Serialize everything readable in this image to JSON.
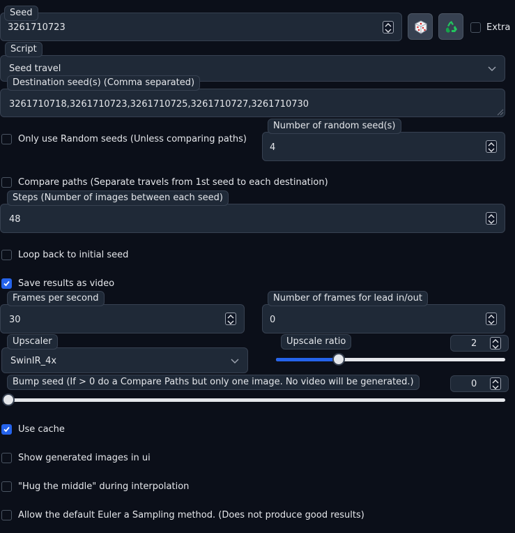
{
  "seed": {
    "label": "Seed",
    "value": "3261710723",
    "extra_label": "Extra"
  },
  "script": {
    "label": "Script",
    "selected": "Seed travel"
  },
  "destination_seeds": {
    "label": "Destination seed(s) (Comma separated)",
    "value": "3261710718,3261710723,3261710725,3261710727,3261710730"
  },
  "only_random": {
    "label": "Only use Random seeds (Unless comparing paths)",
    "checked": false
  },
  "num_random": {
    "label": "Number of random seed(s)",
    "value": "4"
  },
  "compare_paths": {
    "label": "Compare paths (Separate travels from 1st seed to each destination)",
    "checked": false
  },
  "steps": {
    "label": "Steps (Number of images between each seed)",
    "value": "48"
  },
  "loop_back": {
    "label": "Loop back to initial seed",
    "checked": false
  },
  "save_video": {
    "label": "Save results as video",
    "checked": true
  },
  "fps": {
    "label": "Frames per second",
    "value": "30"
  },
  "lead_frames": {
    "label": "Number of frames for lead in/out",
    "value": "0"
  },
  "upscaler": {
    "label": "Upscaler",
    "selected": "SwinIR_4x"
  },
  "upscale_ratio": {
    "label": "Upscale ratio",
    "value": "2",
    "slider_fraction": 0.26
  },
  "bump_seed": {
    "label": "Bump seed (If > 0 do a Compare Paths but only one image. No video will be generated.)",
    "value": "0",
    "slider_fraction": 0.0
  },
  "use_cache": {
    "label": "Use cache",
    "checked": true
  },
  "show_images": {
    "label": "Show generated images in ui",
    "checked": false
  },
  "hug_middle": {
    "label": "\"Hug the middle\" during interpolation",
    "checked": false
  },
  "allow_euler": {
    "label": "Allow the default Euler a Sampling method. (Does not produce good results)",
    "checked": false
  },
  "icons": {
    "dice": "dice-icon",
    "recycle": "recycle-icon"
  },
  "colors": {
    "accent": "#2563eb",
    "background": "#0b0f19",
    "panel": "#1f2937",
    "border": "#374151",
    "recycle": "#22c55e"
  }
}
